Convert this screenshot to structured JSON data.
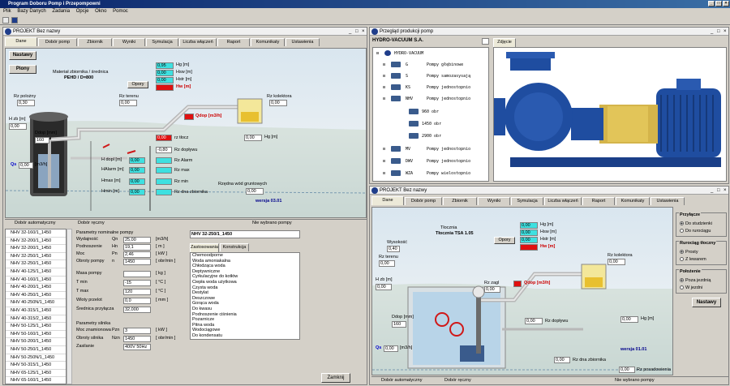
{
  "app": {
    "title": "Program Doboru Pomp i Przepompowni",
    "menu": [
      "Plik",
      "Bazy Danych",
      "Zadania",
      "Opcje",
      "Okno",
      "Pomoc"
    ]
  },
  "win1": {
    "title": "PROJEKT Bez nazwy",
    "tabs": [
      "Dane",
      "Dobór pomp",
      "Zbiornik",
      "Wyniki",
      "Symulacja",
      "Liczba włączeń",
      "Raport",
      "Komunikaty",
      "Ustawienia"
    ],
    "buttons": {
      "nastawy": "Nastawy",
      "piony": "Piony"
    },
    "material": "Materiał zbiornika / średnica",
    "material_val": "PEHD / D=800",
    "fields": {
      "hg_top_lbl": "Hg [m]",
      "hg_top": "0,95",
      "hsw_lbl": "Hsw [m]",
      "hsw": "0,00",
      "hstr_lbl": "Hstr [m]",
      "hstr": "0,00",
      "hw_lbl": "Hw [m]",
      "opory": "Opory",
      "rz_polozny": "Rz polożny",
      "rz_polozny_val": "0,30",
      "rz_terenu": "Rz terenu",
      "rz_terenu_val": "0,00",
      "rz_kolektora": "Rz kolektora",
      "rz_kolektora_val": "0,00",
      "h_zb": "H zb [m]",
      "h_zb_val": "0,00",
      "ddop": "Ddop [mm]",
      "ddop_val": "160",
      "qdop": "Qdop [m3/h]",
      "hg_lbl": "Hg [m]",
      "hg_val": "0,00",
      "qs": "Qs",
      "qs_val": "0,00",
      "qs_unit": "[m3/h]",
      "rz_tl_val": "0,00",
      "rz_tl": "rz tłocz",
      "rz_doplywu_val": "-0,80",
      "rz_doplywu": "Rz dopływu",
      "h_dopl": "H dopl [m]",
      "h_dopl_val": "0,00",
      "rz_alarm": "Rz Alarm",
      "halarm": "HAlarm [m]",
      "halarm_val": "0,00",
      "rz_max": "Rz max",
      "hmax": "Hmax [m]",
      "hmax_val": "0,00",
      "rz_min": "Rz min",
      "hmin": "Hmin [m]",
      "hmin_val": "0,00",
      "rz_dna": "Rz dna zbiornika",
      "rz_wod": "Rzędna wód gruntowych",
      "rz_wod_val": "0,00",
      "wersja": "wersja 03.01"
    },
    "status": [
      "Dobór automatyczny",
      "Dobór ręczny",
      "Nie wybrano pompy"
    ],
    "pump_list": [
      "NHV 32-160/1_1450",
      "NHV 32-200/1_1450",
      "NHV 32-200/1_1450",
      "NHV 32-250/1_1450",
      "NHV 32-250/1_1450",
      "NHV 40-125/1_1450",
      "NHV 40-160/1_1450",
      "NHV 40-200/1_1450",
      "NHV 40-250/1_1450",
      "NHV 40-250N/1_1450",
      "NHV 40-315/1_1450",
      "NHV 40-315/2_1450",
      "NHV 50-125/1_1450",
      "NHV 50-160/1_1450",
      "NHV 50-200/1_1450",
      "NHV 50-250/1_1450",
      "NHV 50-250N/1_1450",
      "NHV 50-315/1_1450",
      "NHV 65-125/1_1450",
      "NHV 65-160/1_1450"
    ],
    "params_title": "Parametry nominalne pompy",
    "params": [
      [
        "Wydajność",
        "Qn",
        "25,00",
        "[m3/h]"
      ],
      [
        "Podnoszenie",
        "Hn",
        "19,1",
        "[ m ]"
      ],
      [
        "Moc",
        "Pn",
        "2,46",
        "[ kW ]"
      ],
      [
        "Obroty pompy",
        "n",
        "1450",
        "[ obr/min ]"
      ]
    ],
    "params2": [
      [
        "Masa pompy",
        "",
        "",
        "[ kg ]"
      ],
      [
        "T min",
        "",
        "-15",
        "[ °C ]"
      ],
      [
        "T max",
        "",
        "120",
        "[ °C ]"
      ],
      [
        "Wloty przelot",
        "",
        "0,0",
        "[ mm ]"
      ],
      [
        "Średnica przyłącza",
        "",
        "32,000",
        ""
      ]
    ],
    "motor_title": "Parametry silnika",
    "motor": [
      [
        "Moc znamionowa",
        "Pzn",
        "3",
        "[ kW ]"
      ],
      [
        "Obroty silnika",
        "Nzn",
        "1450",
        "[ obr/min ]"
      ],
      [
        "Zasilanie",
        "",
        "400V 50Hz",
        ""
      ]
    ],
    "pump_name": "NHV 32-250/1_1450",
    "subtabs": [
      "Zastosowania",
      "Konstrukcja"
    ],
    "apps": [
      "Chemoodporne",
      "Woda amoniakalna",
      "Chłodząca woda",
      "Deptywniczne",
      "Cyrkulacyjne do kotłów",
      "Ciepła woda użytkowa",
      "Czysta woda",
      "Destylat",
      "Deszczowe",
      "Gorąca woda",
      "Do kwasu",
      "Podnoszenie ciśnienia",
      "Pozarnicze",
      "Pitna woda",
      "Wodociągowe",
      "Do kondensatu"
    ],
    "zamknij": "Zamknij"
  },
  "win2": {
    "title": "Przegląd produkcji pomp",
    "company": "HYDRO-VACUUM S.A.",
    "photo_tab": "Zdjęcie",
    "tree": [
      [
        "0",
        "HYDRO-VACUUM",
        ""
      ],
      [
        "1",
        "G",
        "Pompy głębinowe"
      ],
      [
        "1",
        "S",
        "Pompy samozasysają"
      ],
      [
        "1",
        "KS",
        "Pompy jednostopnio"
      ],
      [
        "1",
        "NHV",
        "Pompy jednostopnio"
      ],
      [
        "2",
        "960 obr",
        ""
      ],
      [
        "2",
        "1450 obr",
        ""
      ],
      [
        "2",
        "2900 obr",
        ""
      ],
      [
        "1",
        "MV",
        "Pompy jednostopnio"
      ],
      [
        "1",
        "DWV",
        "Pompy jednostopnio"
      ],
      [
        "1",
        "WZA",
        "Pompy wielostopnio"
      ]
    ]
  },
  "win3": {
    "title": "PROJEKT Bez nazwy",
    "tabs": [
      "Dane",
      "Dobór pomp",
      "Zbiornik",
      "Wyniki",
      "Symulacja",
      "Liczba włączeń",
      "Raport",
      "Komunikaty",
      "Ustawienia"
    ],
    "tlocznia": "Tłocznia",
    "tlocznia_val": "Tłocznia TSA 1.05",
    "fields": {
      "hg": "Hg [m]",
      "hg_val": "0,00",
      "hsw": "Hsw [m]",
      "hsw_val": "0,00",
      "hstr": "Hstr [m]",
      "hstr_val": "0,00",
      "hw": "Hw [m]",
      "opory": "Opory",
      "wysokosc": "Wysokość",
      "wysokosc_val": "0,40",
      "rz_terenu": "Rz terenu",
      "rz_terenu_val": "0,00",
      "rz_kolektora": "Rz kolektora",
      "rz_kolektora_val": "0,00",
      "hzb": "H zb [m]",
      "hzb_val": "0,00",
      "rz_zagl": "Rz zagl",
      "rz_zagl_val": "0,00",
      "qdop": "Qdop [m3/h]",
      "ddop": "Ddop [mm]",
      "ddop_val": "160",
      "hg2": "Hg [m]",
      "hg2_val": "0,00",
      "rz_doplywu": "Rz dopływu",
      "rz_doplywu_val": "0,00",
      "qs": "Qs",
      "qs_val": "0,00",
      "qs_unit": "[m3/h]",
      "rz_dna": "Rz dna zbiornika",
      "rz_dna_val": "0,00",
      "rz_posadowienia": "Rz posadowienia",
      "rz_posad_val": "0,00",
      "wersja": "wersja 01.01"
    },
    "groups": {
      "g1": {
        "title": "Przyłącze",
        "opts": [
          "Do studzienki",
          "Do rurociągu"
        ]
      },
      "g2": {
        "title": "Rurociąg tłoczny",
        "opts": [
          "Prosty",
          "Z lewarem"
        ]
      },
      "g3": {
        "title": "Położenie",
        "opts": [
          "Poza jezdnią",
          "W jezdni"
        ]
      }
    },
    "nastawy": "Nastawy",
    "status": [
      "Dobór automatyczny",
      "Dobór ręczny",
      "Nie wybrano pompy"
    ]
  }
}
